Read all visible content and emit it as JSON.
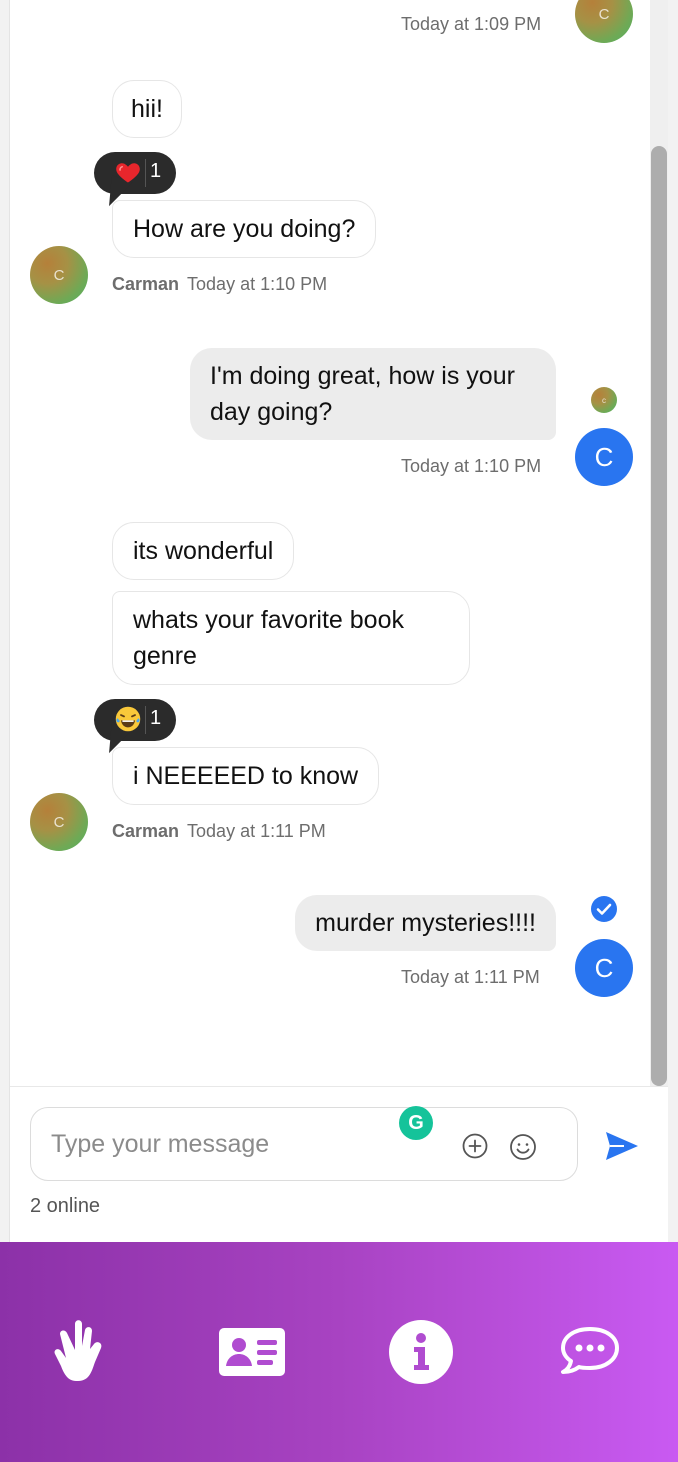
{
  "messages": {
    "top_timestamp": "Today at 1:09 PM",
    "other_avatar_letter": "C",
    "self_avatar_letter": "C",
    "group1": {
      "bubbles": [
        "hii!",
        "How are you doing?"
      ],
      "reaction": {
        "emoji": "heart-emoji",
        "count": "1"
      },
      "sender": "Carman",
      "timestamp": "Today at 1:10 PM"
    },
    "out1": {
      "text": "I'm doing great, how is your day going?",
      "timestamp": "Today at 1:10 PM",
      "read_avatar_letter": "c"
    },
    "group2": {
      "bubbles": [
        "its wonderful",
        "whats your favorite book genre",
        "i NEEEEED to know"
      ],
      "reaction": {
        "emoji": "laughing-emoji",
        "count": "1"
      },
      "sender": "Carman",
      "timestamp": "Today at 1:11 PM"
    },
    "out2": {
      "text": "murder mysteries!!!!",
      "timestamp": "Today at 1:11 PM",
      "status": "delivered-check-icon"
    }
  },
  "composer": {
    "placeholder": "Type your message",
    "grammarly_letter": "G",
    "online_count": "2 online"
  },
  "nav": {
    "items": [
      "hand-icon",
      "contact-card-icon",
      "info-icon",
      "chat-bubble-icon"
    ]
  },
  "colors": {
    "accent": "#2975f0",
    "nav_gradient_start": "#8c31a8",
    "nav_gradient_end": "#c95af2",
    "outgoing_bubble": "#ececec"
  }
}
